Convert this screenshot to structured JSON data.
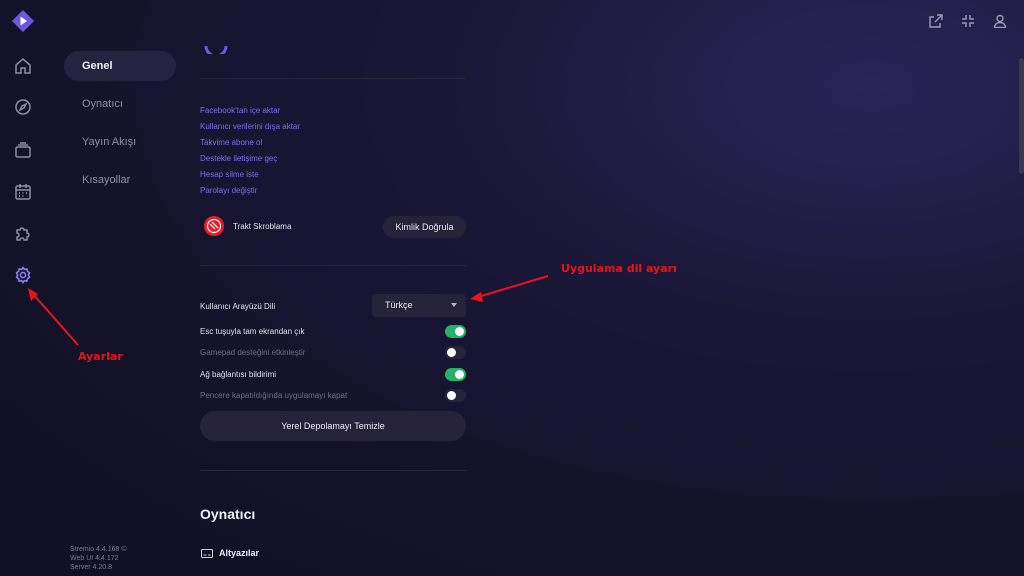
{
  "header": {
    "icons": [
      "external-link-icon",
      "minimize-icon",
      "profile-icon"
    ]
  },
  "rail": {
    "items": [
      "home-icon",
      "discover-icon",
      "library-icon",
      "calendar-icon",
      "addons-icon",
      "settings-icon"
    ]
  },
  "subnav": {
    "items": [
      {
        "label": "Genel",
        "active": true
      },
      {
        "label": "Oynatıcı",
        "active": false
      },
      {
        "label": "Yayın Akışı",
        "active": false
      },
      {
        "label": "Kısayollar",
        "active": false
      }
    ]
  },
  "version": {
    "line1": "Stremio 4.4.168 ©",
    "line2": "Web UI 4.4.172",
    "line3": "Server 4.20.8"
  },
  "links": [
    "Facebook'tan içe aktar",
    "Kullanıcı verilerini dışa aktar",
    "Takvime abone ol",
    "Destekle iletişime geç",
    "Hesap silme iste",
    "Parolayı değiştir"
  ],
  "trakt": {
    "label": "Trakt Skroblama",
    "button": "Kimlik Doğrula"
  },
  "settings": {
    "language_label": "Kullanıcı Arayüzü Dili",
    "language_value": "Türkçe",
    "esc_label": "Esc tuşuyla tam ekrandan çık",
    "esc_on": true,
    "gamepad_label": "Gamepad desteğini etkinleştir",
    "gamepad_on": false,
    "network_label": "Ağ bağlantısı bildirimi",
    "network_on": true,
    "quit_label": "Pencere kapatıldığında uygulamayı kapat",
    "quit_on": false,
    "clear_storage": "Yerel Depolamayı Temizle"
  },
  "player_section": {
    "title": "Oynatıcı",
    "subtitles": "Altyazılar"
  },
  "annotations": {
    "language": "Uygulama dil ayarı",
    "settings": "Ayarlar"
  },
  "colors": {
    "accent": "#7c6cf0",
    "toggle_on": "#22b365",
    "annotation": "#e8141a"
  }
}
